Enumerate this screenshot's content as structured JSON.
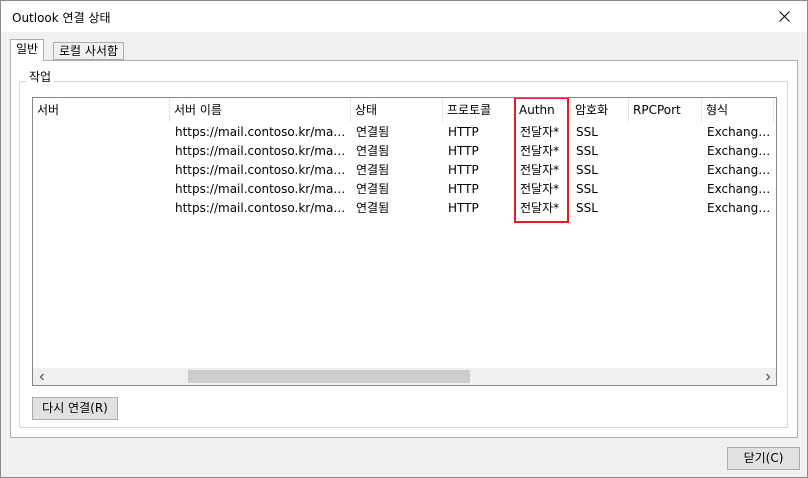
{
  "window": {
    "title": "Outlook 연결 상태",
    "close_icon": "close-icon"
  },
  "tabs": [
    {
      "label": "일반",
      "active": true
    },
    {
      "label": "로컬 사서함",
      "active": false
    }
  ],
  "group": {
    "label": "작업"
  },
  "table": {
    "columns": [
      "서버",
      "서버 이름",
      "상태",
      "프로토콜",
      "Authn",
      "암호화",
      "RPCPort",
      "형식"
    ],
    "rows": [
      [
        "",
        "https://mail.contoso.kr/mapi/...",
        "연결됨",
        "HTTP",
        "전달자*",
        "SSL",
        "",
        "Exchange..."
      ],
      [
        "",
        "https://mail.contoso.kr/mapi/...",
        "연결됨",
        "HTTP",
        "전달자*",
        "SSL",
        "",
        "Exchange..."
      ],
      [
        "",
        "https://mail.contoso.kr/mapi/...",
        "연결됨",
        "HTTP",
        "전달자*",
        "SSL",
        "",
        "Exchange..."
      ],
      [
        "",
        "https://mail.contoso.kr/mapi/...",
        "연결됨",
        "HTTP",
        "전달자*",
        "SSL",
        "",
        "Exchange..."
      ],
      [
        "",
        "https://mail.contoso.kr/mapi/...",
        "연결됨",
        "HTTP",
        "전달자*",
        "SSL",
        "",
        "Exchange..."
      ]
    ],
    "highlight_color": "#e02020"
  },
  "scrollbar": {
    "left_icon": "chevron-left-icon",
    "right_icon": "chevron-right-icon"
  },
  "buttons": {
    "reconnect": "다시 연결(R)",
    "close": "닫기(C)"
  }
}
